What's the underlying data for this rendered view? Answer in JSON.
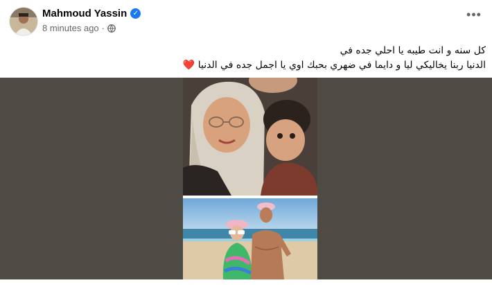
{
  "post": {
    "author": "Mahmoud Yassin",
    "timestamp": "8 minutes ago",
    "separator": "·",
    "privacy_icon": "globe-icon",
    "more_icon": "more-options-icon",
    "verified_icon": "verified-badge-icon",
    "text_line1": "كل سنه و انت طيبه  يا احلي جده في",
    "text_line2": "الدنيا ربنا يخاليكي ليا و دايما في ضهري بحبك اوي يا اجمل جده في الدنيا",
    "emoji": "❤️"
  },
  "colors": {
    "author": "#050505",
    "meta": "#65676b",
    "verified": "#1877f2",
    "media_background": "#4e4a44",
    "heart": "#e41e3f"
  }
}
